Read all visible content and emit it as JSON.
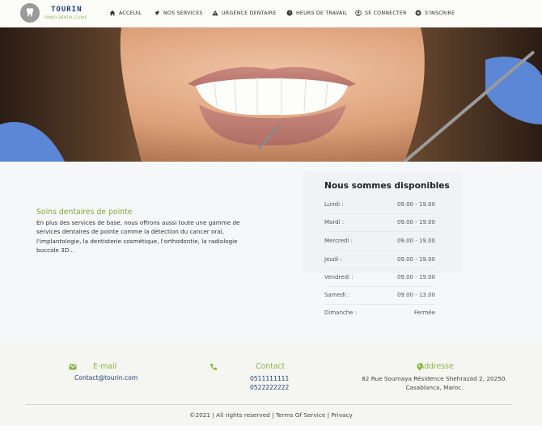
{
  "brand": {
    "name": "TOURIN",
    "tagline": "FAMILY DENTAL CLINIC"
  },
  "nav": {
    "items": [
      {
        "label": "ACCEUIL",
        "icon": "home-icon"
      },
      {
        "label": "NOS SERVICES",
        "icon": "pin-icon"
      },
      {
        "label": "URGENCE DENTAIRE",
        "icon": "warning-icon"
      },
      {
        "label": "HEURS DE TRAVAIL",
        "icon": "clock-icon"
      },
      {
        "label": "SE CONNECTER",
        "icon": "user-circle-icon"
      },
      {
        "label": "S'INSCRIRE",
        "icon": "plus-circle-icon"
      }
    ]
  },
  "feature": {
    "title": "Soins dentaires de pointe",
    "text": "En plus des services de base, nous offrons aussi toute une gamme de services dentaires de pointe comme la détection du cancer oral, l'implantologie, la dentisterie cosmétique, l'orthodontie, la radiologie buccale 3D..."
  },
  "hours": {
    "title": "Nous sommes disponibles",
    "rows": [
      {
        "day": "Lundi :",
        "time": "09.00 - 19.00"
      },
      {
        "day": "Mardi :",
        "time": "09.00 - 19.00"
      },
      {
        "day": "Mercredi :",
        "time": "09.00 - 19.00"
      },
      {
        "day": "Jeudi :",
        "time": "09.00 - 19.00"
      },
      {
        "day": "Vendredi :",
        "time": "09.00 - 19.00"
      },
      {
        "day": "Samedi :",
        "time": "09.00 - 13.00"
      },
      {
        "day": "Dimanche :",
        "time": "Fermée"
      }
    ]
  },
  "footer": {
    "email": {
      "heading": "E-mail",
      "value": "Contact@tourin.com",
      "icon": "envelope-icon"
    },
    "contact": {
      "heading": "Contact",
      "phone1": "0511111111",
      "phone2": "0522222222",
      "icon": "phone-icon"
    },
    "address": {
      "heading": "Addresse",
      "line1": "82 Rue Soumaya Résidence Shehrazad 2, 20250.",
      "line2": "Casablanca, Maroc.",
      "icon": "map-pin-icon"
    },
    "copyright": "©2021 | All rights reserved | Terms Of Service | Privacy"
  },
  "colors": {
    "accent": "#8cb445",
    "navy": "#1c3f73",
    "nav_bg": "#fbfbf7",
    "page_bg": "#f6f7f9",
    "footer_bg": "#f5f5f1"
  }
}
